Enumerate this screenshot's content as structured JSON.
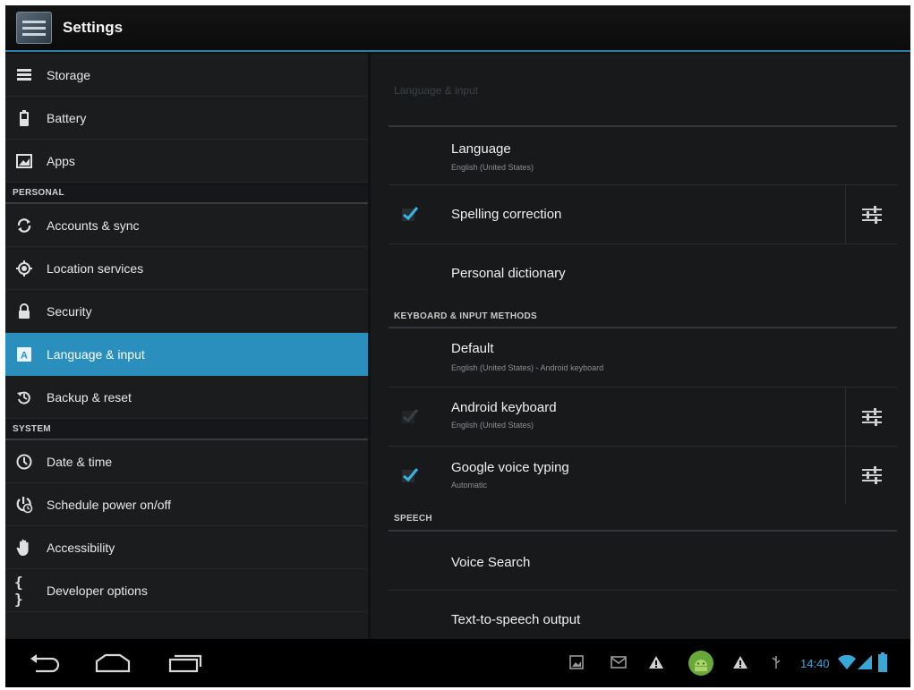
{
  "app": {
    "title": "Settings"
  },
  "sidebar": {
    "items": [
      {
        "label": "Storage",
        "icon": "storage-icon"
      },
      {
        "label": "Battery",
        "icon": "battery-icon"
      },
      {
        "label": "Apps",
        "icon": "apps-icon"
      },
      {
        "label": "Accounts & sync",
        "icon": "sync-icon"
      },
      {
        "label": "Location services",
        "icon": "location-icon"
      },
      {
        "label": "Security",
        "icon": "lock-icon"
      },
      {
        "label": "Language & input",
        "icon": "language-icon"
      },
      {
        "label": "Backup & reset",
        "icon": "backup-icon"
      },
      {
        "label": "Date & time",
        "icon": "clock-icon"
      },
      {
        "label": "Schedule power on/off",
        "icon": "power-schedule-icon"
      },
      {
        "label": "Accessibility",
        "icon": "hand-icon"
      },
      {
        "label": "Developer options",
        "icon": "braces-icon"
      }
    ],
    "sections": {
      "personal": "PERSONAL",
      "system": "SYSTEM"
    },
    "selected": "Language & input"
  },
  "pane": {
    "title": "Language & input",
    "language": {
      "title": "Language",
      "summary": "English (United States)"
    },
    "spelling": {
      "title": "Spelling correction",
      "checked": true
    },
    "dictionary": {
      "title": "Personal dictionary"
    },
    "keyboard_section": "KEYBOARD & INPUT METHODS",
    "default": {
      "title": "Default",
      "summary": "English (United States) - Android keyboard"
    },
    "android_keyboard": {
      "title": "Android keyboard",
      "summary": "English (United States)",
      "checked": true
    },
    "voice_typing": {
      "title": "Google voice typing",
      "summary": "Automatic",
      "checked": true
    },
    "speech_section": "SPEECH",
    "voice_search": {
      "title": "Voice Search"
    },
    "tts": {
      "title": "Text-to-speech output"
    }
  },
  "statusbar": {
    "time": "14:40"
  },
  "colors": {
    "accent": "#2a8fbd",
    "clock": "#38a7d8",
    "check": "#33b5e5"
  }
}
